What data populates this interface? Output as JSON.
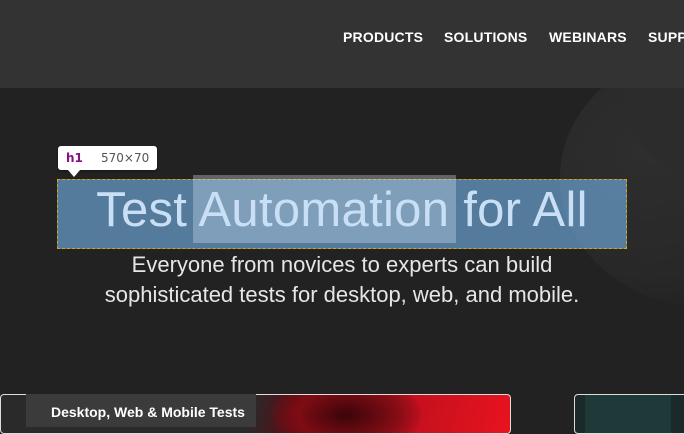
{
  "nav": {
    "items": [
      {
        "label": "PRODUCTS"
      },
      {
        "label": "SOLUTIONS"
      },
      {
        "label": "WEBINARS"
      },
      {
        "label": "SUPP"
      }
    ]
  },
  "inspector": {
    "tag": "h1",
    "dimensions": "570×70"
  },
  "hero": {
    "title": "Test Automation for All",
    "subtitle_line1": "Everyone from novices to experts can build",
    "subtitle_line2": "sophisticated tests for desktop, web, and mobile."
  },
  "cards": {
    "left_label": "Desktop, Web & Mobile Tests"
  },
  "colors": {
    "header_bg": "#333333",
    "page_bg": "#222222",
    "highlight": "#6fa8dc",
    "accent_red": "#e8131f"
  }
}
